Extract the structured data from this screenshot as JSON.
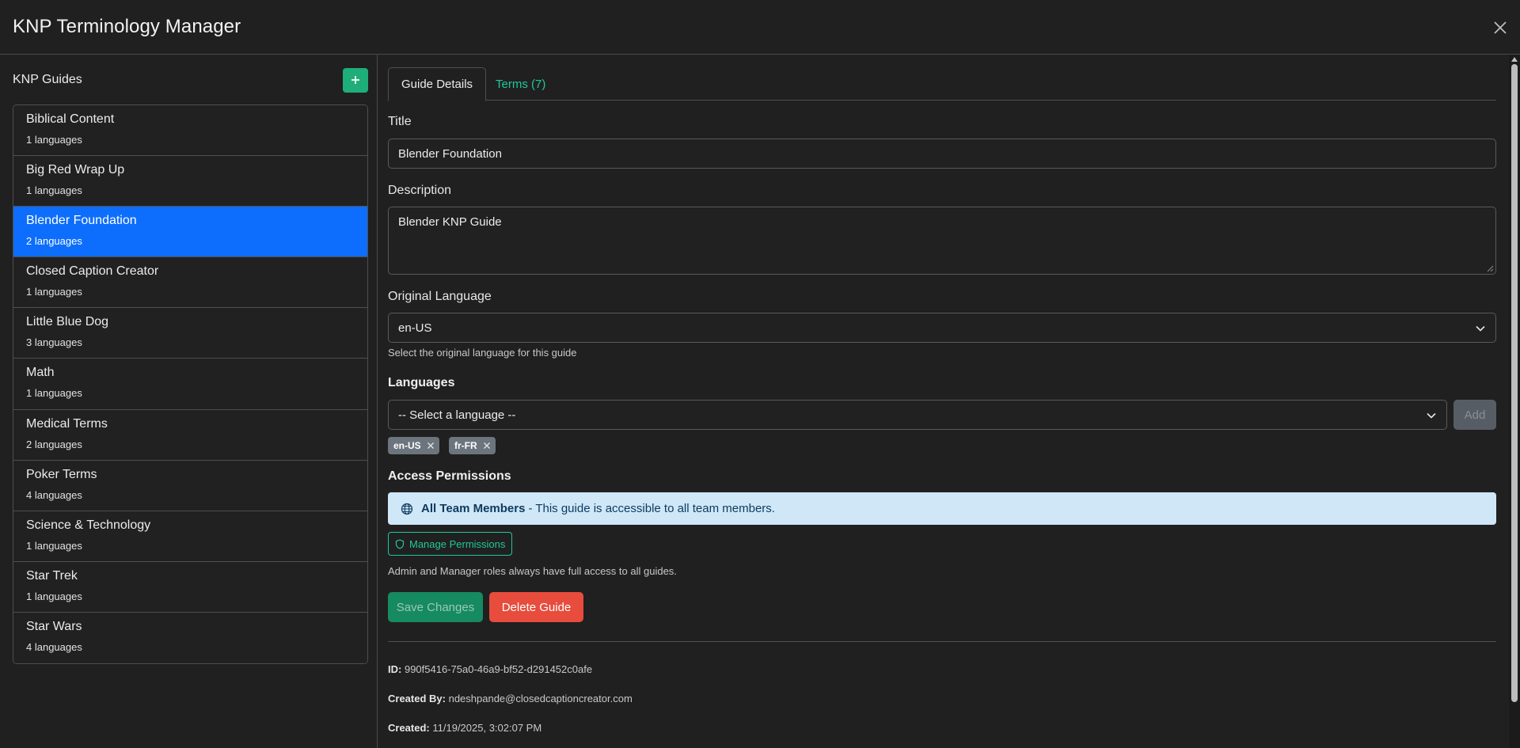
{
  "header": {
    "title": "KNP Terminology Manager"
  },
  "sidebar": {
    "title": "KNP Guides",
    "add_label": "+",
    "guides": [
      {
        "name": "Biblical Content",
        "count": "1 languages"
      },
      {
        "name": "Big Red Wrap Up",
        "count": "1 languages"
      },
      {
        "name": "Blender Foundation",
        "count": "2 languages",
        "selected": true
      },
      {
        "name": "Closed Caption Creator",
        "count": "1 languages"
      },
      {
        "name": "Little Blue Dog",
        "count": "3 languages"
      },
      {
        "name": "Math",
        "count": "1 languages"
      },
      {
        "name": "Medical Terms",
        "count": "2 languages"
      },
      {
        "name": "Poker Terms",
        "count": "4 languages"
      },
      {
        "name": "Science & Technology",
        "count": "1 languages"
      },
      {
        "name": "Star Trek",
        "count": "1 languages"
      },
      {
        "name": "Star Wars",
        "count": "4 languages"
      }
    ]
  },
  "tabs": [
    {
      "label": "Guide Details",
      "active": true
    },
    {
      "label": "Terms (7)",
      "active": false
    }
  ],
  "form": {
    "title_label": "Title",
    "title_value": "Blender Foundation",
    "description_label": "Description",
    "description_value": "Blender KNP Guide",
    "original_language_label": "Original Language",
    "original_language_value": "en-US",
    "original_language_help": "Select the original language for this guide",
    "languages_label": "Languages",
    "language_select_value": "-- Select a language --",
    "add_button": "Add",
    "language_tags": [
      "en-US",
      "fr-FR"
    ],
    "access_label": "Access Permissions",
    "access_strong": "All Team Members",
    "access_text": "- This guide is accessible to all team members.",
    "manage_button": "Manage Permissions",
    "access_help": "Admin and Manager roles always have full access to all guides.",
    "save_button": "Save Changes",
    "delete_button": "Delete Guide"
  },
  "meta": {
    "id_label": "ID:",
    "id_value": "990f5416-75a0-46a9-bf52-d291452c0afe",
    "created_by_label": "Created By:",
    "created_by_value": "ndeshpande@closedcaptioncreator.com",
    "created_label": "Created:",
    "created_value": "11/19/2025, 3:02:07 PM"
  },
  "colors": {
    "accent": "#20c997",
    "selected": "#0d6efd",
    "danger": "#e74c3c",
    "info_bg": "#cfe7f7"
  },
  "icons": [
    "close-icon",
    "plus-icon",
    "chevron-down-icon",
    "globe-icon",
    "shield-icon",
    "tag-remove-icon"
  ]
}
